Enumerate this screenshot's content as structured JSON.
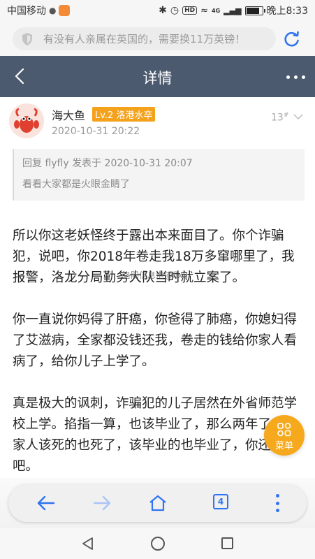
{
  "status_bar": {
    "carrier": "中国移动",
    "network": "4G",
    "hd": "HD",
    "time": "晚上8:33"
  },
  "search": {
    "placeholder": "有没有人亲属在英国的，需要换11万英镑！"
  },
  "header": {
    "title": "详情"
  },
  "post": {
    "username": "海大鱼",
    "level": "Lv.2 洛港水卒",
    "timestamp": "2020-10-31 20:22",
    "floor": "13",
    "floor_mark": "#",
    "quote": {
      "header": "回复 flyfly 发表于 2020-10-31 20:07",
      "text": "看看大家都是火眼金睛了"
    },
    "paragraphs": [
      "所以你这老妖怪终于露出本来面目了。你个诈骗犯，说吧，你2018年卷走我18万多窜哪里了，我报警，洛龙分局勤务大队当时就立案了。",
      "你一直说你妈得了肝癌，你爸得了肺癌，你媳妇得了艾滋病，全家都没钱还我，卷走的钱给你家人看病了，给你儿子上学了。",
      "真是极大的讽刺，诈骗犯的儿子居然在外省师范学校上学。掐指一算，也该毕业了，那么两年了，你家人该死的也死了，该毕业的也毕业了，你还钱吧。"
    ],
    "watermark": "洛阳信息港@flxk"
  },
  "fab": {
    "label": "菜单"
  },
  "toolbar": {
    "tab_count": "4"
  },
  "colors": {
    "titlebar": "#4b5a6e",
    "accent_orange": "#f6a91d",
    "browser_blue": "#2f74f0"
  }
}
